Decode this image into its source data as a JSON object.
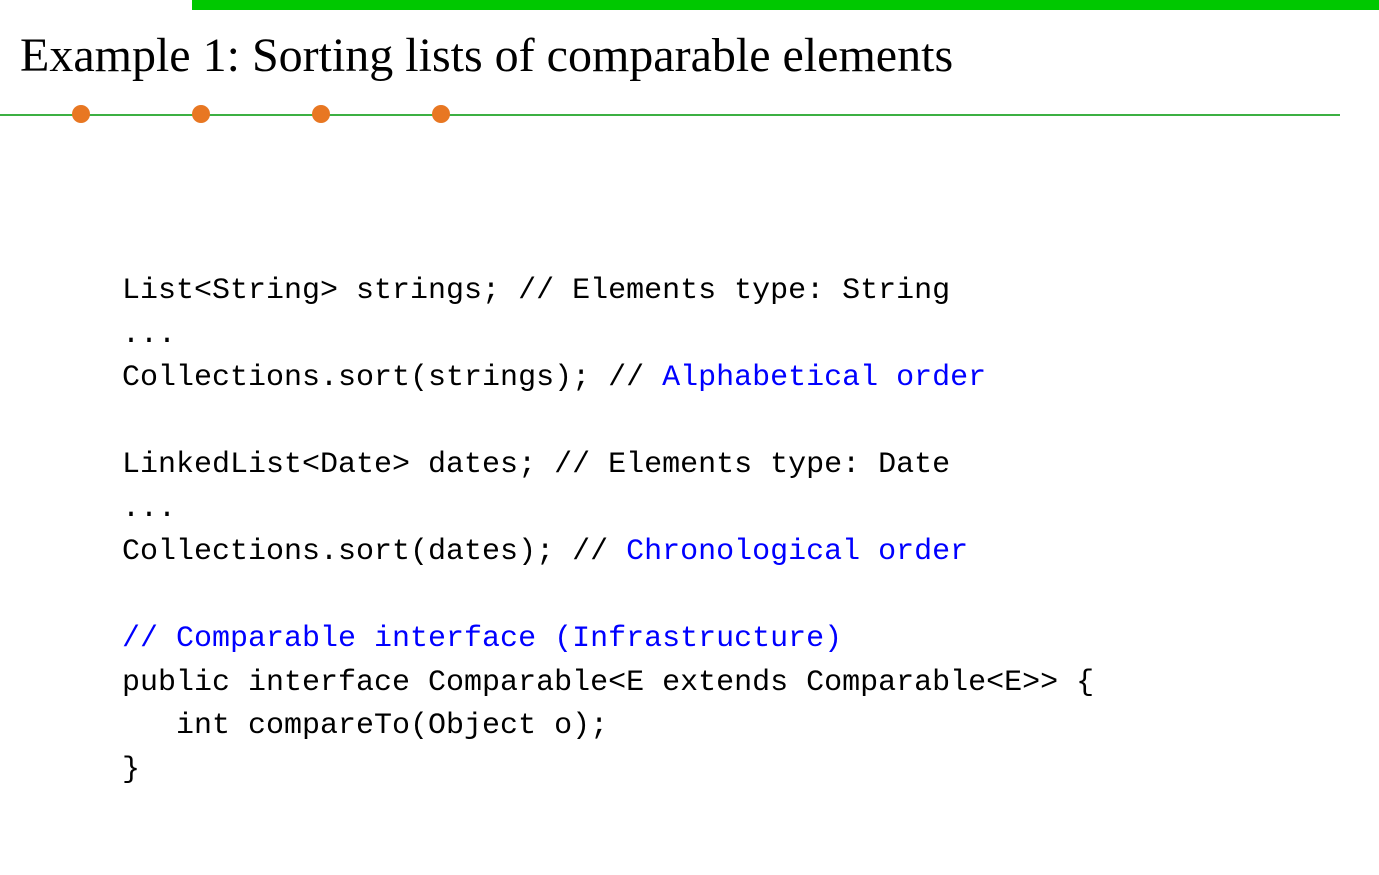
{
  "title": "Example 1: Sorting lists of comparable elements",
  "code": {
    "line1_a": "List<String> strings; // Elements type: String",
    "line2": "...",
    "line3_a": "Collections.sort(strings); // ",
    "line3_b": "Alphabetical order",
    "line4": "",
    "line5": "LinkedList<Date> dates; // Elements type: Date",
    "line6": "...",
    "line7_a": "Collections.sort(dates); // ",
    "line7_b": "Chronological order",
    "line8": "",
    "line9": "// Comparable interface (Infrastructure)",
    "line10": "public interface Comparable<E extends Comparable<E>> {",
    "line11": "   int compareTo(Object o);",
    "line12": "}"
  }
}
